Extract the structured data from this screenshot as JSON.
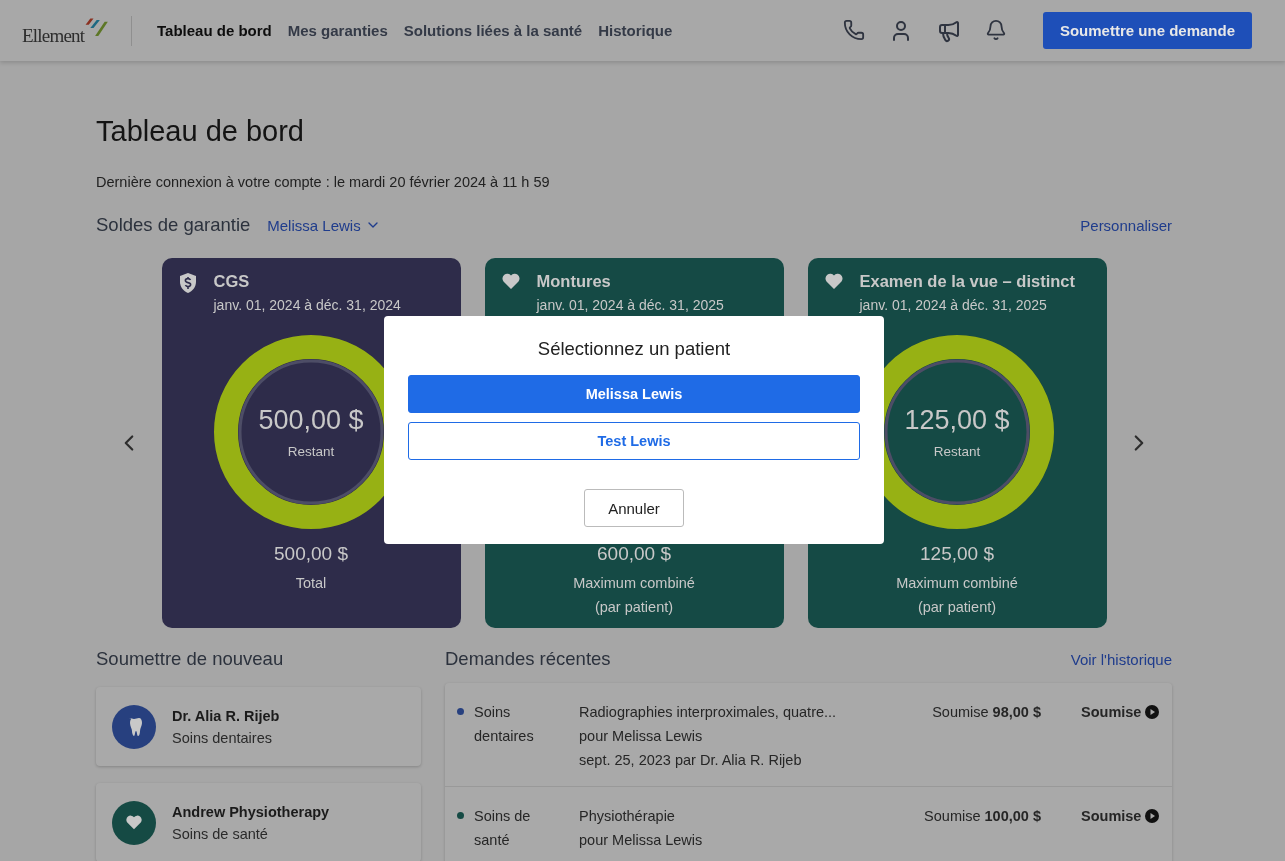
{
  "header": {
    "logo": {
      "name": "Ellement"
    },
    "nav": [
      {
        "label": "Tableau de bord",
        "selected": true
      },
      {
        "label": "Mes garanties",
        "selected": false
      },
      {
        "label": "Solutions liées à la santé",
        "selected": false
      },
      {
        "label": "Historique",
        "selected": false
      }
    ],
    "submit_button": "Soumettre une demande"
  },
  "page": {
    "title": "Tableau de bord",
    "last_login": "Dernière connexion à votre compte : le mardi 20 février 2024 à 11 h 59"
  },
  "balances": {
    "title": "Soldes de garantie",
    "patient": "Melissa Lewis",
    "customize_link": "Personnaliser",
    "cards": [
      {
        "kind": "shield",
        "color": "#2e2c4a",
        "title": "CGS",
        "period": "janv. 01, 2024 à déc. 31, 2024",
        "remaining": "500,00 $",
        "remaining_label": "Restant",
        "total": "500,00 $",
        "total_label": "Total"
      },
      {
        "kind": "heart",
        "color": "#154a45",
        "title": "Montures",
        "period": "janv. 01, 2024 à déc. 31, 2025",
        "total": "600,00 $",
        "total_label": "Maximum combiné\n(par patient)"
      },
      {
        "kind": "heart",
        "color": "#154a45",
        "title": "Examen de la vue – distinct",
        "period": "janv. 01, 2024 à déc. 31, 2025",
        "remaining": "125,00 $",
        "remaining_label": "Restant",
        "total": "125,00 $",
        "total_label": "Maximum combiné\n(par patient)"
      }
    ]
  },
  "resubmit": {
    "title": "Soumettre de nouveau",
    "providers": [
      {
        "kind": "tooth",
        "name": "Dr. Alia R. Rijeb",
        "category": "Soins dentaires",
        "color": "#27407f"
      },
      {
        "kind": "heart",
        "name": "Andrew Physiotherapy",
        "category": "Soins de santé",
        "color": "#154a44"
      }
    ]
  },
  "recent": {
    "title": "Demandes récentes",
    "history_link": "Voir l'historique",
    "rows": [
      {
        "category": "Soins\ndentaires",
        "color": "#27407f",
        "description": "Radiographies interproximales, quatre...",
        "patient": "pour Melissa Lewis",
        "date": "sept. 25, 2023 par Dr. Alia R. Rijeb",
        "amount": "Soumise **98,00 $**",
        "status": "Soumise"
      },
      {
        "category": "Soins de\nsanté",
        "color": "#154a44",
        "description": "Physiothérapie",
        "patient": "pour Melissa Lewis",
        "amount": "Soumise **100,00 $**",
        "status": "Soumise"
      }
    ]
  },
  "modal": {
    "title": "Sélectionnez un patient",
    "options": [
      {
        "label": "Melissa Lewis",
        "selected": true
      },
      {
        "label": "Test Lewis",
        "selected": false
      }
    ],
    "cancel": "Annuler"
  }
}
